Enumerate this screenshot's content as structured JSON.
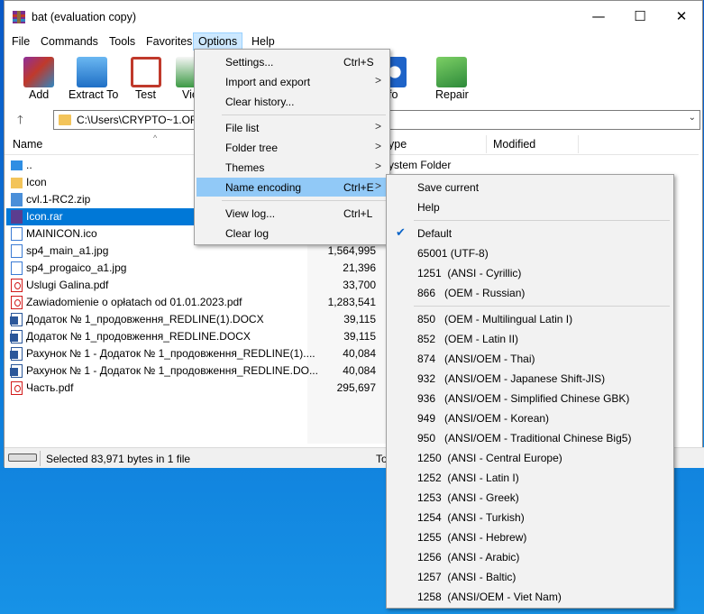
{
  "window": {
    "title": "bat (evaluation copy)",
    "minimize": "—",
    "maximize": "☐",
    "close": "✕"
  },
  "menubar": [
    "File",
    "Commands",
    "Tools",
    "Favorites",
    "Options",
    "Help"
  ],
  "toolbar": {
    "add": "Add",
    "extract": "Extract To",
    "test": "Test",
    "view": "Vie",
    "info": "fo",
    "repair": "Repair"
  },
  "address": {
    "up": "🡑",
    "path": "C:\\Users\\CRYPTO~1.ORG",
    "dropdown": "⌄"
  },
  "columns": {
    "name": "Name",
    "sort": "^",
    "type": "ype",
    "modified": "Modified"
  },
  "files": [
    {
      "name": "..",
      "size": "",
      "type": "ystem Folder"
    },
    {
      "name": "Icon",
      "size": "",
      "type": ""
    },
    {
      "name": "cvl.1-RC2.zip",
      "size": "",
      "type": ""
    },
    {
      "name": "Icon.rar",
      "size": "",
      "type": ""
    },
    {
      "name": "MAINICON.ico",
      "size": "",
      "type": ""
    },
    {
      "name": "sp4_main_a1.jpg",
      "size": "1,564,995",
      "type": ""
    },
    {
      "name": "sp4_progaico_a1.jpg",
      "size": "21,396",
      "type": ""
    },
    {
      "name": "Uslugi Galina.pdf",
      "size": "33,700",
      "type": ""
    },
    {
      "name": "Zawiadomienie o opłatach od 01.01.2023.pdf",
      "size": "1,283,541",
      "type": ""
    },
    {
      "name": "Додаток № 1_продовження_REDLINE(1).DOCX",
      "size": "39,115",
      "type": ""
    },
    {
      "name": "Додаток № 1_продовження_REDLINE.DOCX",
      "size": "39,115",
      "type": ""
    },
    {
      "name": "Рахунок № 1 - Додаток № 1_продовження_REDLINE(1)....",
      "size": "40,084",
      "type": ""
    },
    {
      "name": "Рахунок № 1 - Додаток № 1_продовження_REDLINE.DO...",
      "size": "40,084",
      "type": ""
    },
    {
      "name": "Часть.pdf",
      "size": "295,697",
      "type": ""
    }
  ],
  "status": {
    "text": "Selected 83,971 bytes in 1 file",
    "right": "To"
  },
  "options_menu": [
    {
      "label": "Settings...",
      "shortcut": "Ctrl+S",
      "sub": ""
    },
    {
      "label": "Import and export",
      "shortcut": "",
      "sub": ">"
    },
    {
      "label": "Clear history...",
      "shortcut": "",
      "sub": ""
    },
    {
      "label": "File list",
      "shortcut": "",
      "sub": ">"
    },
    {
      "label": "Folder tree",
      "shortcut": "",
      "sub": ">"
    },
    {
      "label": "Themes",
      "shortcut": "",
      "sub": ">"
    },
    {
      "label": "Name encoding",
      "shortcut": "Ctrl+E",
      "sub": ">"
    },
    {
      "label": "View log...",
      "shortcut": "Ctrl+L",
      "sub": ""
    },
    {
      "label": "Clear log",
      "shortcut": "",
      "sub": ""
    }
  ],
  "encoding_menu": {
    "checkmark": "✔",
    "items": [
      "Save current",
      "Help",
      "Default",
      "65001 (UTF-8)",
      "1251  (ANSI - Cyrillic)",
      "866   (OEM - Russian)",
      "850   (OEM - Multilingual Latin I)",
      "852   (OEM - Latin II)",
      "874   (ANSI/OEM - Thai)",
      "932   (ANSI/OEM - Japanese Shift-JIS)",
      "936   (ANSI/OEM - Simplified Chinese GBK)",
      "949   (ANSI/OEM - Korean)",
      "950   (ANSI/OEM - Traditional Chinese Big5)",
      "1250  (ANSI - Central Europe)",
      "1252  (ANSI - Latin I)",
      "1253  (ANSI - Greek)",
      "1254  (ANSI - Turkish)",
      "1255  (ANSI - Hebrew)",
      "1256  (ANSI - Arabic)",
      "1257  (ANSI - Baltic)",
      "1258  (ANSI/OEM - Viet Nam)"
    ]
  },
  "colors": {
    "selection": "#0078d7",
    "menu_highlight": "#91c9f7",
    "menu_active": "#cce8ff"
  }
}
